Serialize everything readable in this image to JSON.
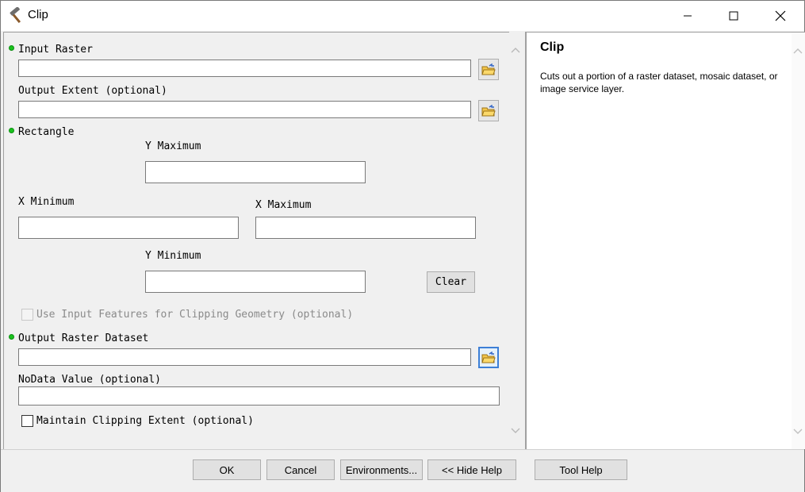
{
  "window": {
    "title": "Clip"
  },
  "form": {
    "input_raster_label": "Input Raster",
    "input_raster_value": "",
    "output_extent_label": "Output Extent (optional)",
    "output_extent_value": "",
    "rectangle_label": "Rectangle",
    "y_maximum_label": "Y Maximum",
    "y_maximum_value": "",
    "x_minimum_label": "X Minimum",
    "x_minimum_value": "",
    "x_maximum_label": "X Maximum",
    "x_maximum_value": "",
    "y_minimum_label": "Y Minimum",
    "y_minimum_value": "",
    "clear_label": "Clear",
    "use_input_features_label": "Use Input Features for Clipping Geometry (optional)",
    "use_input_features_checked": false,
    "output_raster_label": "Output Raster Dataset",
    "output_raster_value": "",
    "nodata_label": "NoData Value (optional)",
    "nodata_value": "",
    "maintain_extent_label": "Maintain Clipping Extent (optional)",
    "maintain_extent_checked": false
  },
  "help": {
    "title": "Clip",
    "text": "Cuts out a portion of a raster dataset, mosaic dataset, or image service layer."
  },
  "buttons": {
    "ok": "OK",
    "cancel": "Cancel",
    "environments": "Environments...",
    "hide_help": "<< Hide Help",
    "tool_help": "Tool Help"
  },
  "colors": {
    "required_dot": "#19c21d",
    "focus_border": "#3d7fd6"
  },
  "icons": {
    "app": "hammer-icon",
    "browse": "open-folder-icon"
  }
}
